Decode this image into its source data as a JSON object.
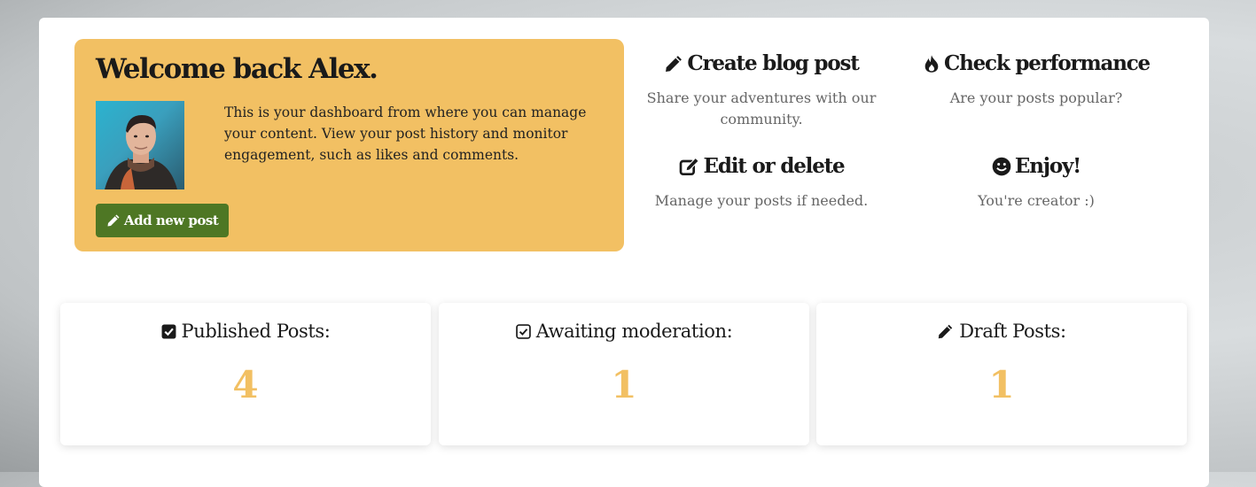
{
  "welcome": {
    "heading": "Welcome back Alex.",
    "description": "This is your dashboard from where you can manage your content. View your post history and monitor engagement, such as likes and comments.",
    "add_button_label": "Add new post",
    "add_button_icon": "pencil-icon"
  },
  "features": [
    {
      "title": "Create blog post",
      "text": "Share your adventures with our community.",
      "icon": "pencil-icon"
    },
    {
      "title": "Check performance",
      "text": "Are your posts popular?",
      "icon": "fire-icon"
    },
    {
      "title": "Edit or delete",
      "text": "Manage your posts if needed.",
      "icon": "edit-square-icon"
    },
    {
      "title": "Enjoy!",
      "text": "You're creator :)",
      "icon": "smile-icon"
    }
  ],
  "stats": [
    {
      "label": "Published Posts:",
      "value": "4",
      "icon": "checked-square-icon"
    },
    {
      "label": "Awaiting moderation:",
      "value": "1",
      "icon": "check-square-outline-icon"
    },
    {
      "label": "Draft Posts:",
      "value": "1",
      "icon": "pencil-icon"
    }
  ],
  "colors": {
    "accent": "#f2c063",
    "button": "#4e7724",
    "heading": "#1a1a1a",
    "muted_text": "#666666"
  }
}
